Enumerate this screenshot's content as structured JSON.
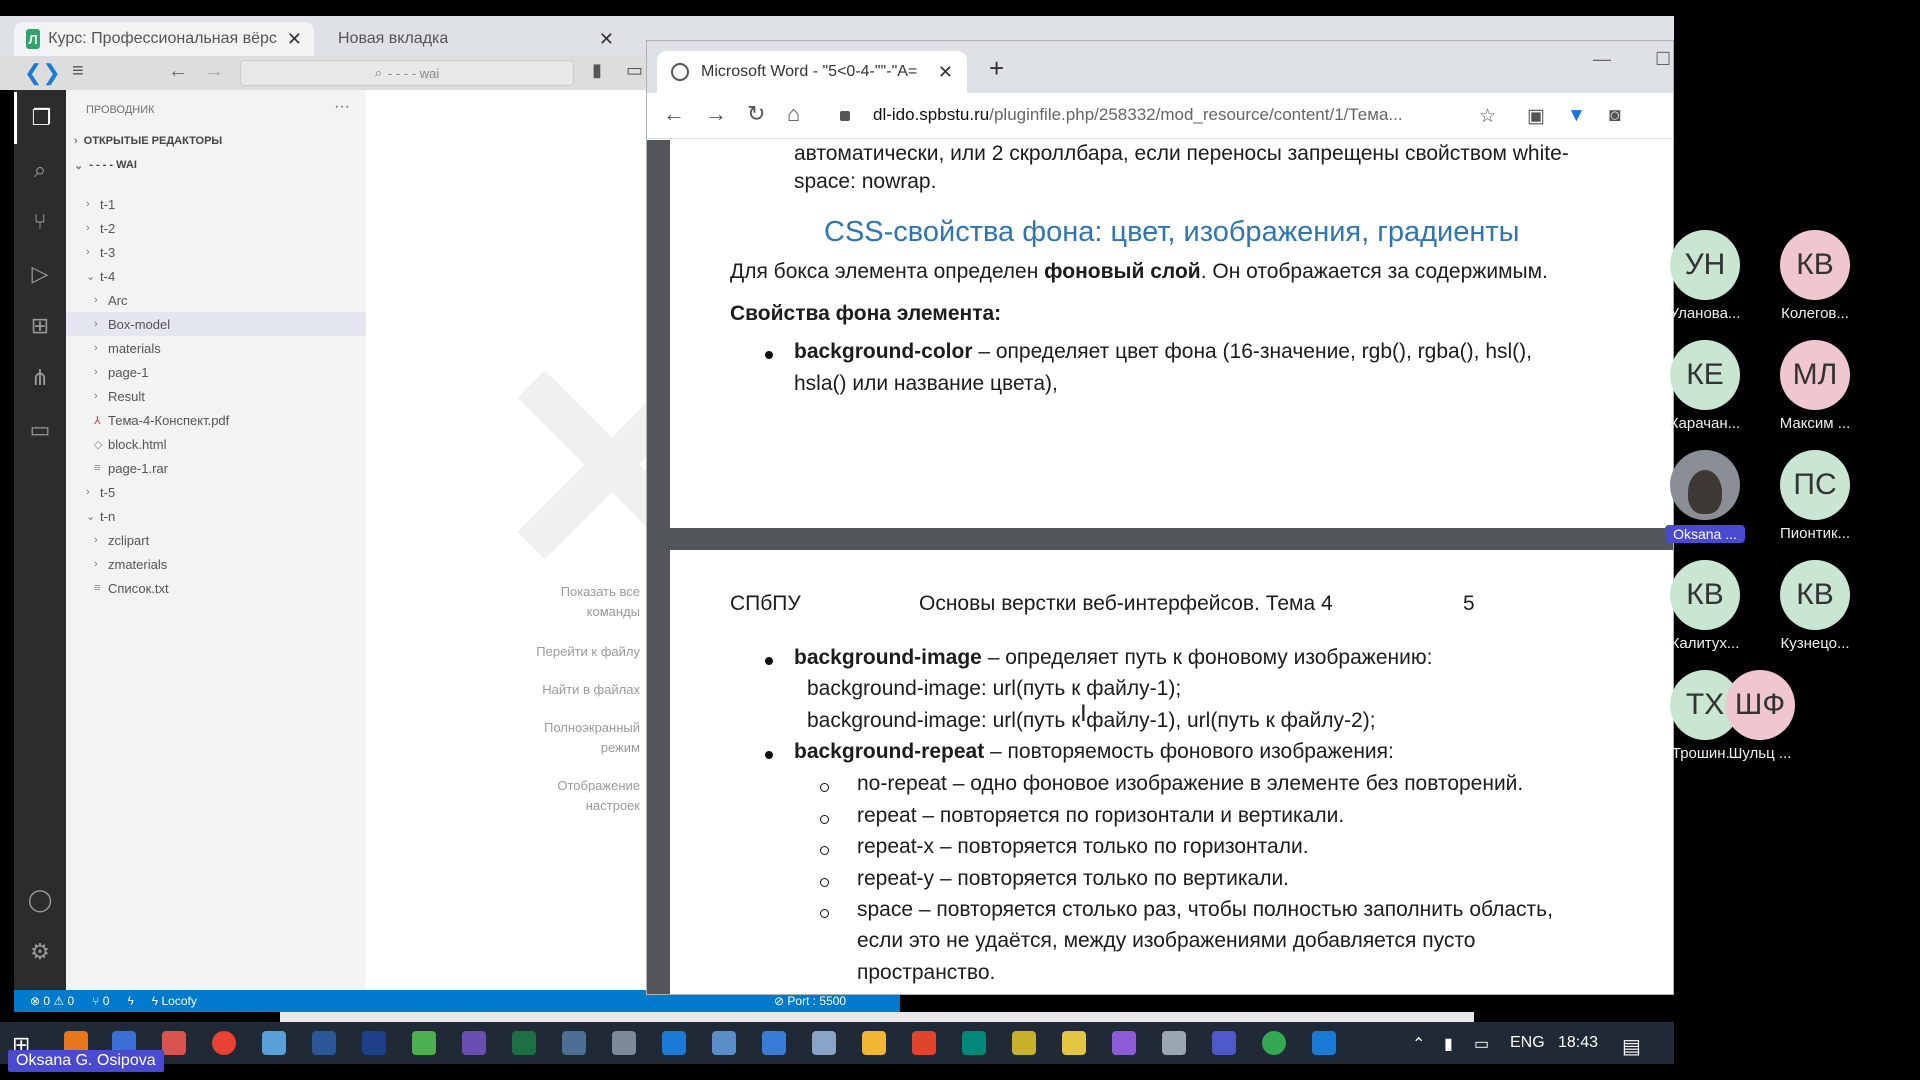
{
  "outer_tabs": [
    {
      "label": "Курс: Профессиональная вёрс"
    },
    {
      "label": "Новая вкладка"
    }
  ],
  "vscode": {
    "search_placeholder": "- - - - wai",
    "explorer_title": "ПРОВОДНИК",
    "open_editors": "ОТКРЫТЫЕ РЕДАКТОРЫ",
    "workspace": "- - - - WAI",
    "tree": [
      {
        "label": "t-1",
        "kind": "folder",
        "level": 1,
        "open": false
      },
      {
        "label": "t-2",
        "kind": "folder",
        "level": 1,
        "open": false
      },
      {
        "label": "t-3",
        "kind": "folder",
        "level": 1,
        "open": false
      },
      {
        "label": "t-4",
        "kind": "folder",
        "level": 1,
        "open": true
      },
      {
        "label": "Arc",
        "kind": "folder",
        "level": 2,
        "open": false
      },
      {
        "label": "Box-model",
        "kind": "folder",
        "level": 2,
        "open": false,
        "selected": true
      },
      {
        "label": "materials",
        "kind": "folder",
        "level": 2,
        "open": false
      },
      {
        "label": "page-1",
        "kind": "folder",
        "level": 2,
        "open": false
      },
      {
        "label": "Result",
        "kind": "folder",
        "level": 2,
        "open": false
      },
      {
        "label": "Тема-4-Конспект.pdf",
        "kind": "pdf",
        "level": 2
      },
      {
        "label": "block.html",
        "kind": "html",
        "level": 2
      },
      {
        "label": "page-1.rar",
        "kind": "file",
        "level": 2
      },
      {
        "label": "t-5",
        "kind": "folder",
        "level": 1,
        "open": false
      },
      {
        "label": "t-n",
        "kind": "folder",
        "level": 1,
        "open": true
      },
      {
        "label": "zclipart",
        "kind": "folder",
        "level": 2,
        "open": false
      },
      {
        "label": "zmaterials",
        "kind": "folder",
        "level": 2,
        "open": false
      },
      {
        "label": "Список.txt",
        "kind": "file",
        "level": 2
      }
    ],
    "hints": [
      {
        "label": "Показать все команды"
      },
      {
        "label": "Перейти к файлу"
      },
      {
        "label": "Найти в файлах"
      },
      {
        "label": "Полноэкранный режим"
      },
      {
        "label": "Отображение настроек"
      }
    ],
    "status": {
      "errors": "0",
      "warnings": "0",
      "ports": "0",
      "locofy": "Locofy",
      "port": "Port : 5500"
    }
  },
  "browser": {
    "tab_title": "Microsoft Word - \"5<0-4-\"\"-\"A=",
    "url_host": "dl-ido.spbstu.ru",
    "url_path": "/pluginfile.php/258332/mod_resource/content/1/Тема..."
  },
  "pdf": {
    "page1": {
      "cont_line1": "автоматически, или  2 скроллбара, если переносы запрещены свойством white-",
      "cont_line2": "space: nowrap.",
      "heading": "CSS-свойства фона: цвет, изображения, градиенты",
      "intro_a": "Для бокса элемента определен ",
      "intro_b": "фоновый слой",
      "intro_c": ". Он отображается за содержимым.",
      "props_title": "Свойства фона элемента:",
      "bg_color_name": "background-color",
      "bg_color_desc": " – определяет цвет фона (16-значение, rgb(), rgba(), hsl(),",
      "bg_color_desc2": "hsla() или название цвета),"
    },
    "page2": {
      "header_left": "СПбПУ",
      "header_center": "Основы верстки веб-интерфейсов. Тема 4",
      "header_right": "5",
      "bg_image_name": "background-image",
      "bg_image_desc": " – определяет путь к фоновому изображению:",
      "bg_image_ex1": "background-image: url(путь к файлу-1);",
      "bg_image_ex2": "background-image: url(путь к файлу-1), url(путь к файлу-2);",
      "bg_repeat_name": "background-repeat",
      "bg_repeat_desc": " – повторяемость фонового изображения:",
      "repeat_items": [
        "no-repeat – одно фоновое изображение в элементе без повторений.",
        "repeat – повторяется по горизонтали и вертикали.",
        "repeat-x – повторяется только по горизонтали.",
        "repeat-y – повторяется только по вертикали.",
        "space – повторяется столько раз, чтобы полностью заполнить область,"
      ],
      "space_cont1": "если это не удаётся, между изображениями добавляется пусто",
      "space_cont2": "пространство."
    }
  },
  "participants": [
    {
      "initials": "УН",
      "name": "Уланова...",
      "color": "#c9e6d3"
    },
    {
      "initials": "КВ",
      "name": "Колегов...",
      "color": "#f1c7cf"
    },
    {
      "initials": "КЕ",
      "name": "Карачан...",
      "color": "#c9e6d3"
    },
    {
      "initials": "МЛ",
      "name": "Максим ...",
      "color": "#f1c7cf"
    },
    {
      "initials": "",
      "name": "Oksana ...",
      "color": "#8a8f96",
      "photo": true
    },
    {
      "initials": "ПС",
      "name": "Пионтик...",
      "color": "#c9e6d3"
    },
    {
      "initials": "КВ",
      "name": "Калитух...",
      "color": "#c9e6d3"
    },
    {
      "initials": "КВ",
      "name": "Кузнецо...",
      "color": "#c9e6d3"
    },
    {
      "initials": "ТХ",
      "name": "Трошин...",
      "color": "#c9e6d3"
    },
    {
      "initials": "ШФ",
      "name": "Шульц ...",
      "color": "#f1c7cf"
    }
  ],
  "taskbar": {
    "lang": "ENG",
    "time": "18:43"
  },
  "speaker_name": "Oksana G. Osipova"
}
